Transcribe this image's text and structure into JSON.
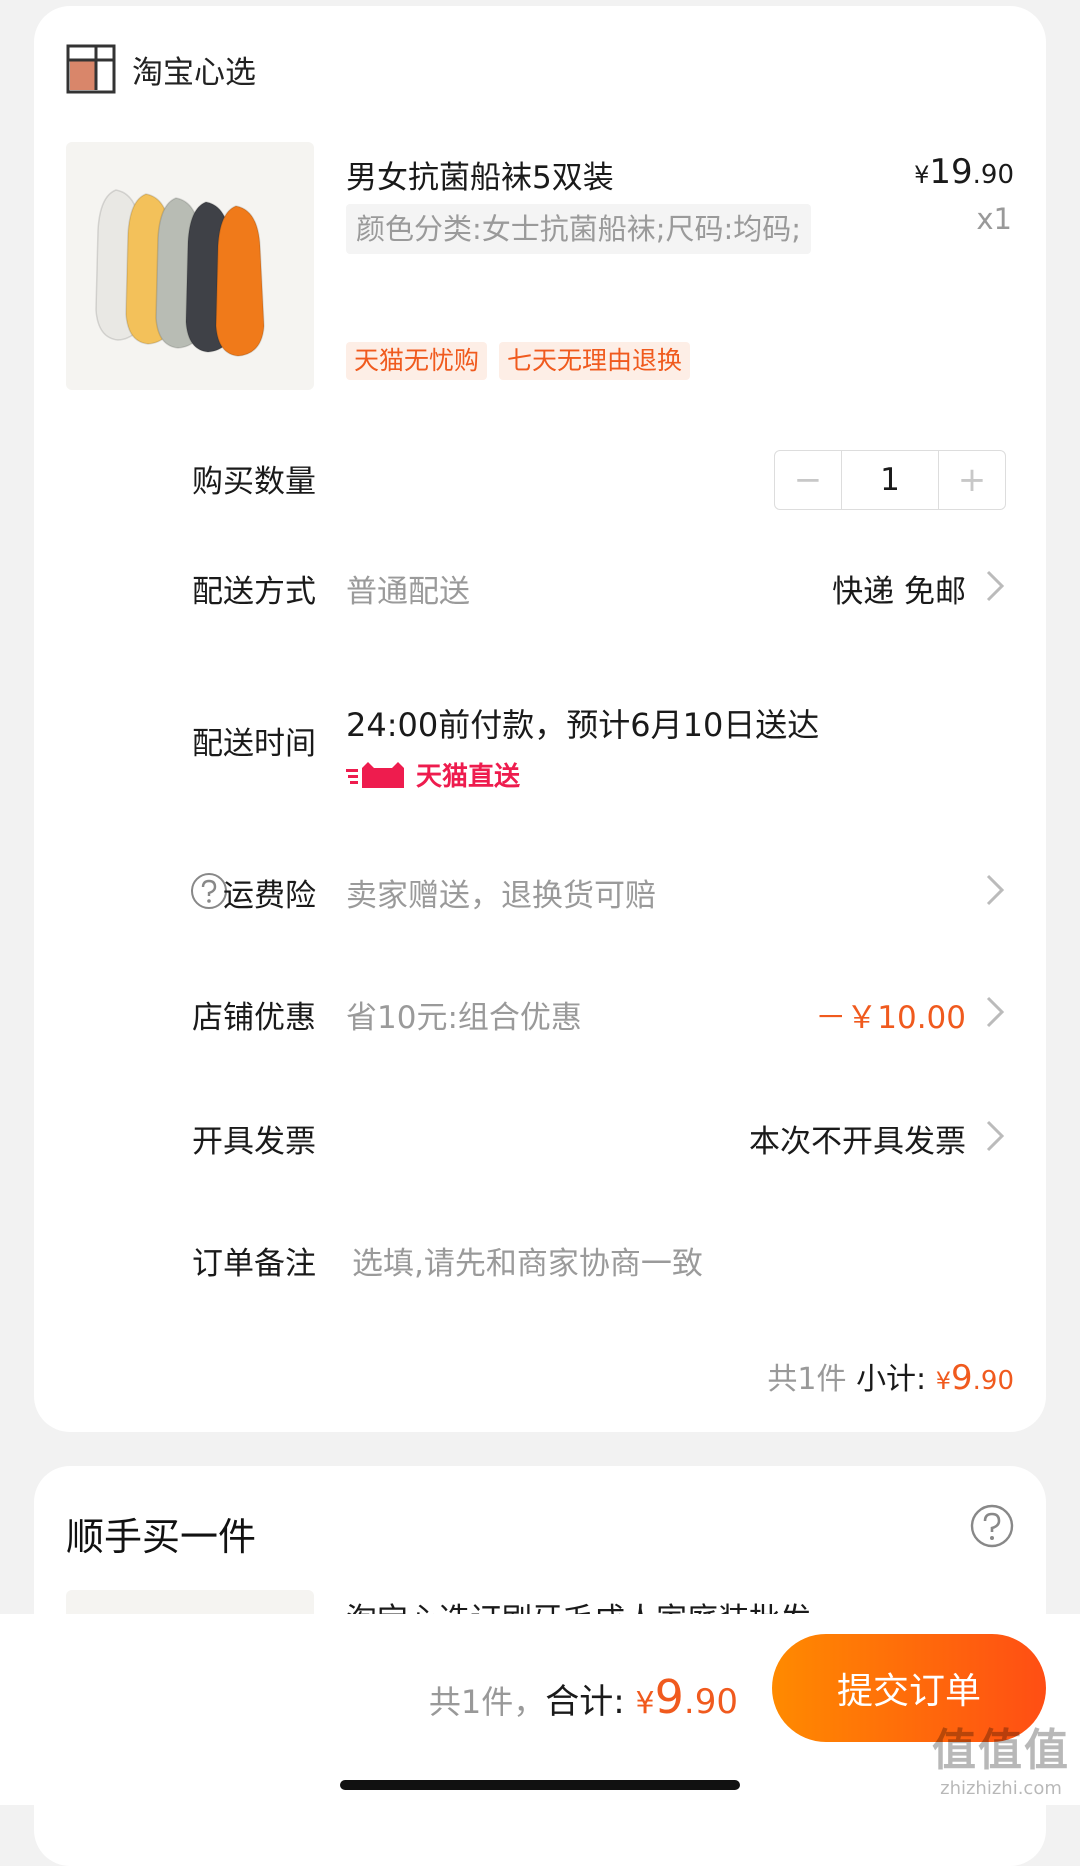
{
  "shop": {
    "name": "淘宝心选",
    "logo_icon": "taobao-xinxuan-logo-icon"
  },
  "product": {
    "title": "男女抗菌船袜5双装",
    "sku": "颜色分类:女士抗菌船袜;尺码:均码;",
    "price": {
      "symbol": "¥",
      "int": "19",
      "dec": ".90"
    },
    "qty_label": "x1",
    "tags": [
      "天猫无忧购",
      "七天无理由退换"
    ],
    "sock_colors": [
      "#e9e8e4",
      "#f3c15a",
      "#b8bcb4",
      "#3f4147",
      "#f07a1a"
    ]
  },
  "quantity": {
    "label": "购买数量",
    "value": "1",
    "minus": "−",
    "plus": "+"
  },
  "delivery": {
    "label": "配送方式",
    "value": "普通配送",
    "right": "快递 免邮"
  },
  "delivery_time": {
    "label": "配送时间",
    "text": "24:00前付款，预计6月10日送达",
    "badge": "天猫直送",
    "badge_color": "#ee1c4e"
  },
  "shipping_insurance": {
    "label": "运费险",
    "value": "卖家赠送，退换货可赔"
  },
  "store_discount": {
    "label": "店铺优惠",
    "value": "省10元:组合优惠",
    "amount": "－￥10.00"
  },
  "invoice": {
    "label": "开具发票",
    "right": "本次不开具发票"
  },
  "remark": {
    "label": "订单备注",
    "placeholder": "选填,请先和商家协商一致"
  },
  "subtotal": {
    "count": "共1件",
    "label": "小计: ",
    "symbol": "¥",
    "int": "9",
    "dec": ".90"
  },
  "upsell": {
    "title": "顺手买一件",
    "item_title": "淘宝心选订刷牙毛成人家庭装批发"
  },
  "footer": {
    "count": "共1件，",
    "label": "合计: ",
    "symbol": "¥",
    "int": "9",
    "dec": ".90",
    "submit": "提交订单"
  },
  "watermark": {
    "main": "值值值",
    "sub": "zhizhizhi.com"
  },
  "colors": {
    "accent": "#f05a1e",
    "tmall_red": "#ee1c4e",
    "button_start": "#ff8a00",
    "button_end": "#ff4e14"
  }
}
